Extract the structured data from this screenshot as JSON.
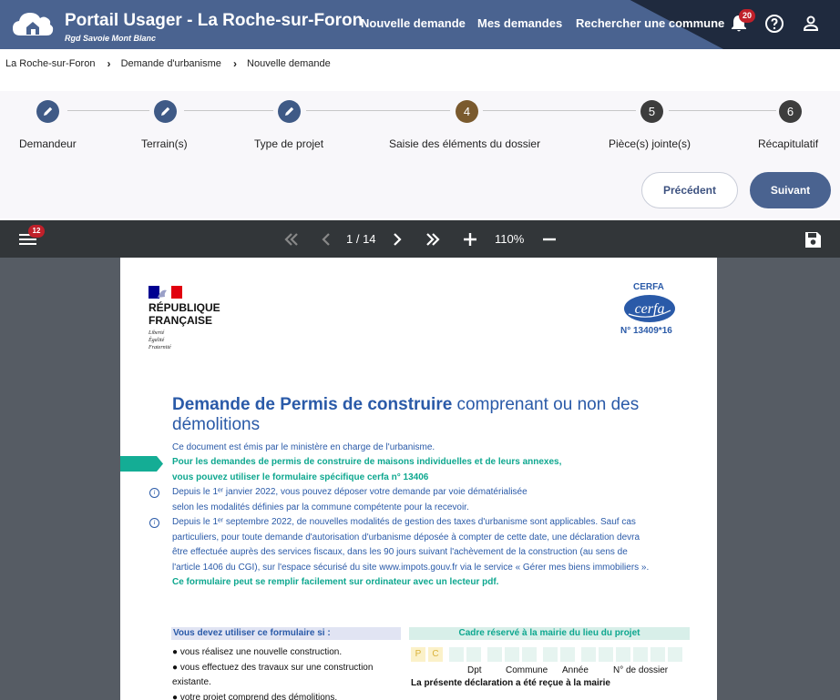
{
  "header": {
    "title": "Portail Usager - La Roche-sur-Foron",
    "subtitle": "Rgd Savoie Mont Blanc",
    "nav": [
      "Nouvelle demande",
      "Mes demandes",
      "Rechercher une commune"
    ],
    "notifications_count": "20",
    "icons": [
      "cloud-home-logo-icon",
      "bell-icon",
      "help-icon",
      "user-icon"
    ]
  },
  "breadcrumb": [
    "La Roche-sur-Foron",
    "Demande d'urbanisme",
    "Nouvelle demande"
  ],
  "stepper": {
    "steps": [
      {
        "number": "",
        "label": "Demandeur",
        "state": "done"
      },
      {
        "number": "",
        "label": "Terrain(s)",
        "state": "done"
      },
      {
        "number": "",
        "label": "Type de projet",
        "state": "done"
      },
      {
        "number": "4",
        "label": "Saisie des éléments du dossier",
        "state": "active"
      },
      {
        "number": "5",
        "label": "Pièce(s) jointe(s)",
        "state": "todo"
      },
      {
        "number": "6",
        "label": "Récapitulatif",
        "state": "todo"
      }
    ],
    "prev_label": "Précédent",
    "next_label": "Suivant"
  },
  "pdf_toolbar": {
    "menu_badge": "12",
    "page_indicator": "1 / 14",
    "zoom": "110%"
  },
  "document": {
    "republic": "RÉPUBLIQUE FRANÇAISE",
    "motto": [
      "Liberté",
      "Égalité",
      "Fraternité"
    ],
    "cerfa_label": "CERFA",
    "cerfa_logo_text": "cerfa",
    "cerfa_number": "N° 13409*16",
    "title_bold": "Demande de Permis de construire",
    "title_rest": " comprenant ou non des démolitions",
    "intro": "Ce document est émis par le ministère en charge de l'urbanisme.",
    "green1": "Pour les demandes de permis de construire de maisons individuelles et de leurs annexes,",
    "green2": "vous pouvez utiliser le formulaire spécifique cerfa n° 13406",
    "info1_l1": "Depuis le 1ᵉʳ janvier 2022, vous pouvez déposer votre demande par voie dématérialisée",
    "info1_l2": "selon les modalités définies par la commune compétente pour la recevoir.",
    "info2_l1": "Depuis le 1ᵉʳ septembre 2022, de nouvelles modalités de gestion des taxes d'urbanisme sont applicables. Sauf cas",
    "info2_l2": "particuliers, pour toute demande d'autorisation d'urbanisme déposée à compter de cette date, une déclaration devra",
    "info2_l3": "être effectuée auprès des services fiscaux, dans les 90 jours suivant l'achèvement de la construction (au sens de",
    "info2_l4": "l'article 1406 du CGI), sur l'espace sécurisé du site www.impots.gouv.fr via le service « Gérer mes biens immobiliers ».",
    "green3": "Ce formulaire peut se remplir facilement sur ordinateur avec un lecteur pdf.",
    "left_head": "Vous devez utiliser ce formulaire si :",
    "bullets": [
      "● vous réalisez une nouvelle construction.",
      "● vous effectuez des travaux sur une construction",
      "existante.",
      "● votre projet comprend des démolitions."
    ],
    "right_head": "Cadre réservé à la mairie du lieu du projet",
    "cell_p": "P",
    "cell_c": "C",
    "cell_labels": [
      "Dpt",
      "Commune",
      "Année",
      "N° de dossier"
    ],
    "received": "La présente déclaration a été reçue à la mairie"
  }
}
